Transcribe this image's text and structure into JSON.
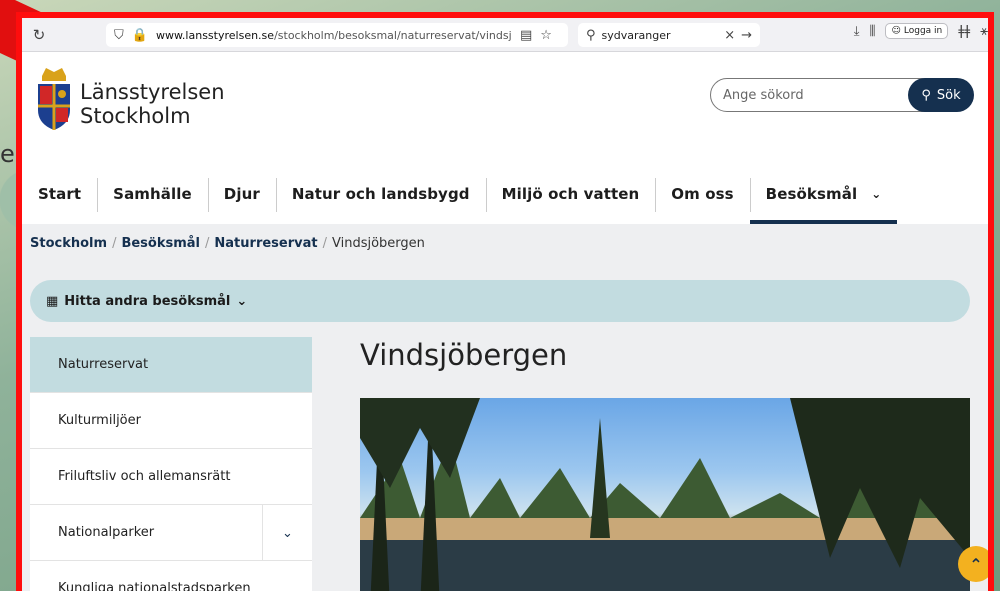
{
  "browser": {
    "url_domain": "www.lansstyrelsen.se",
    "url_path": "/stockholm/besoksmal/naturreservat/vindsjober",
    "search_query": "sydvaranger",
    "login_label": "Logga in"
  },
  "header": {
    "brand_line1": "Länsstyrelsen",
    "brand_line2": "Stockholm",
    "search_placeholder": "Ange sökord",
    "search_button": "Sök"
  },
  "nav": {
    "items": [
      {
        "label": "Start"
      },
      {
        "label": "Samhälle"
      },
      {
        "label": "Djur"
      },
      {
        "label": "Natur och landsbygd"
      },
      {
        "label": "Miljö och vatten"
      },
      {
        "label": "Om oss"
      },
      {
        "label": "Besöksmål"
      }
    ]
  },
  "breadcrumb": {
    "items": [
      "Stockholm",
      "Besöksmål",
      "Naturreservat"
    ],
    "current": "Vindsjöbergen"
  },
  "find_other": "Hitta andra besöksmål",
  "sidebar": {
    "items": [
      {
        "label": "Naturreservat"
      },
      {
        "label": "Kulturmiljöer"
      },
      {
        "label": "Friluftsliv och allemansrätt"
      },
      {
        "label": "Nationalparker"
      },
      {
        "label": "Kungliga nationalstadsparken"
      }
    ]
  },
  "page": {
    "title": "Vindsjöbergen"
  },
  "background": {
    "map_letter": "e"
  },
  "colors": {
    "brand_dark": "#15304f",
    "highlight": "#c2dce0",
    "accent": "#f3b11f",
    "frame": "#ff0d0d"
  }
}
